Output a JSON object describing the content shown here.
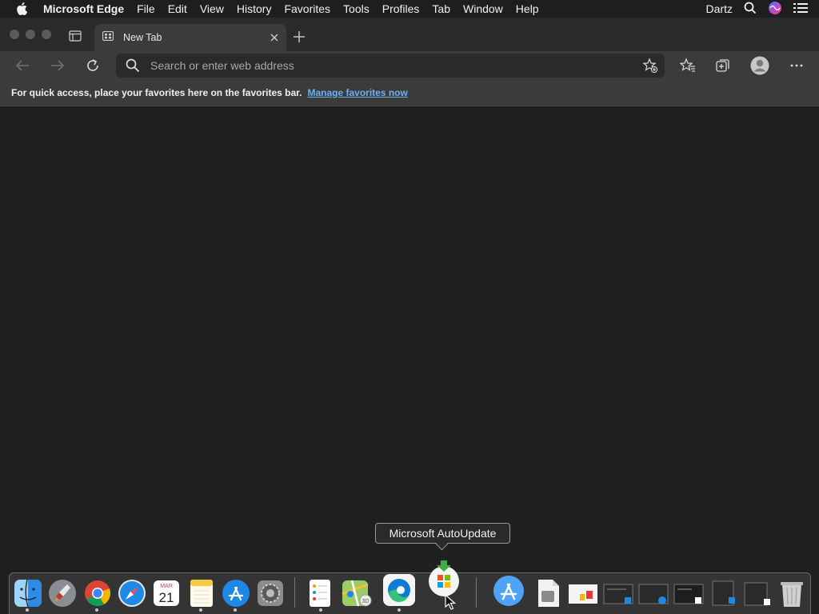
{
  "menubar": {
    "app": "Microsoft Edge",
    "items": [
      "File",
      "Edit",
      "View",
      "History",
      "Favorites",
      "Tools",
      "Profiles",
      "Tab",
      "Window",
      "Help"
    ],
    "user": "Dartz"
  },
  "tab": {
    "title": "New Tab"
  },
  "address_bar": {
    "placeholder": "Search or enter web address"
  },
  "favorites_bar": {
    "message": "For quick access, place your favorites here on the favorites bar.",
    "link": "Manage favorites now"
  },
  "tooltip": {
    "text": "Microsoft AutoUpdate"
  },
  "dock": {
    "items": [
      "finder-icon",
      "launchpad-icon",
      "chrome-icon",
      "safari-icon",
      "calendar-icon",
      "notes-icon",
      "app-store-icon",
      "system-preferences-icon",
      "reminders-icon",
      "maps-icon",
      "edge-icon",
      "autoupdate-icon",
      "applications-folder-icon",
      "downloads-icon"
    ],
    "calendar_month": "MAR",
    "calendar_day": "21"
  },
  "colors": {
    "accent": "#6ab1ef",
    "background": "#202020",
    "chrome": "#3b3b3b"
  }
}
